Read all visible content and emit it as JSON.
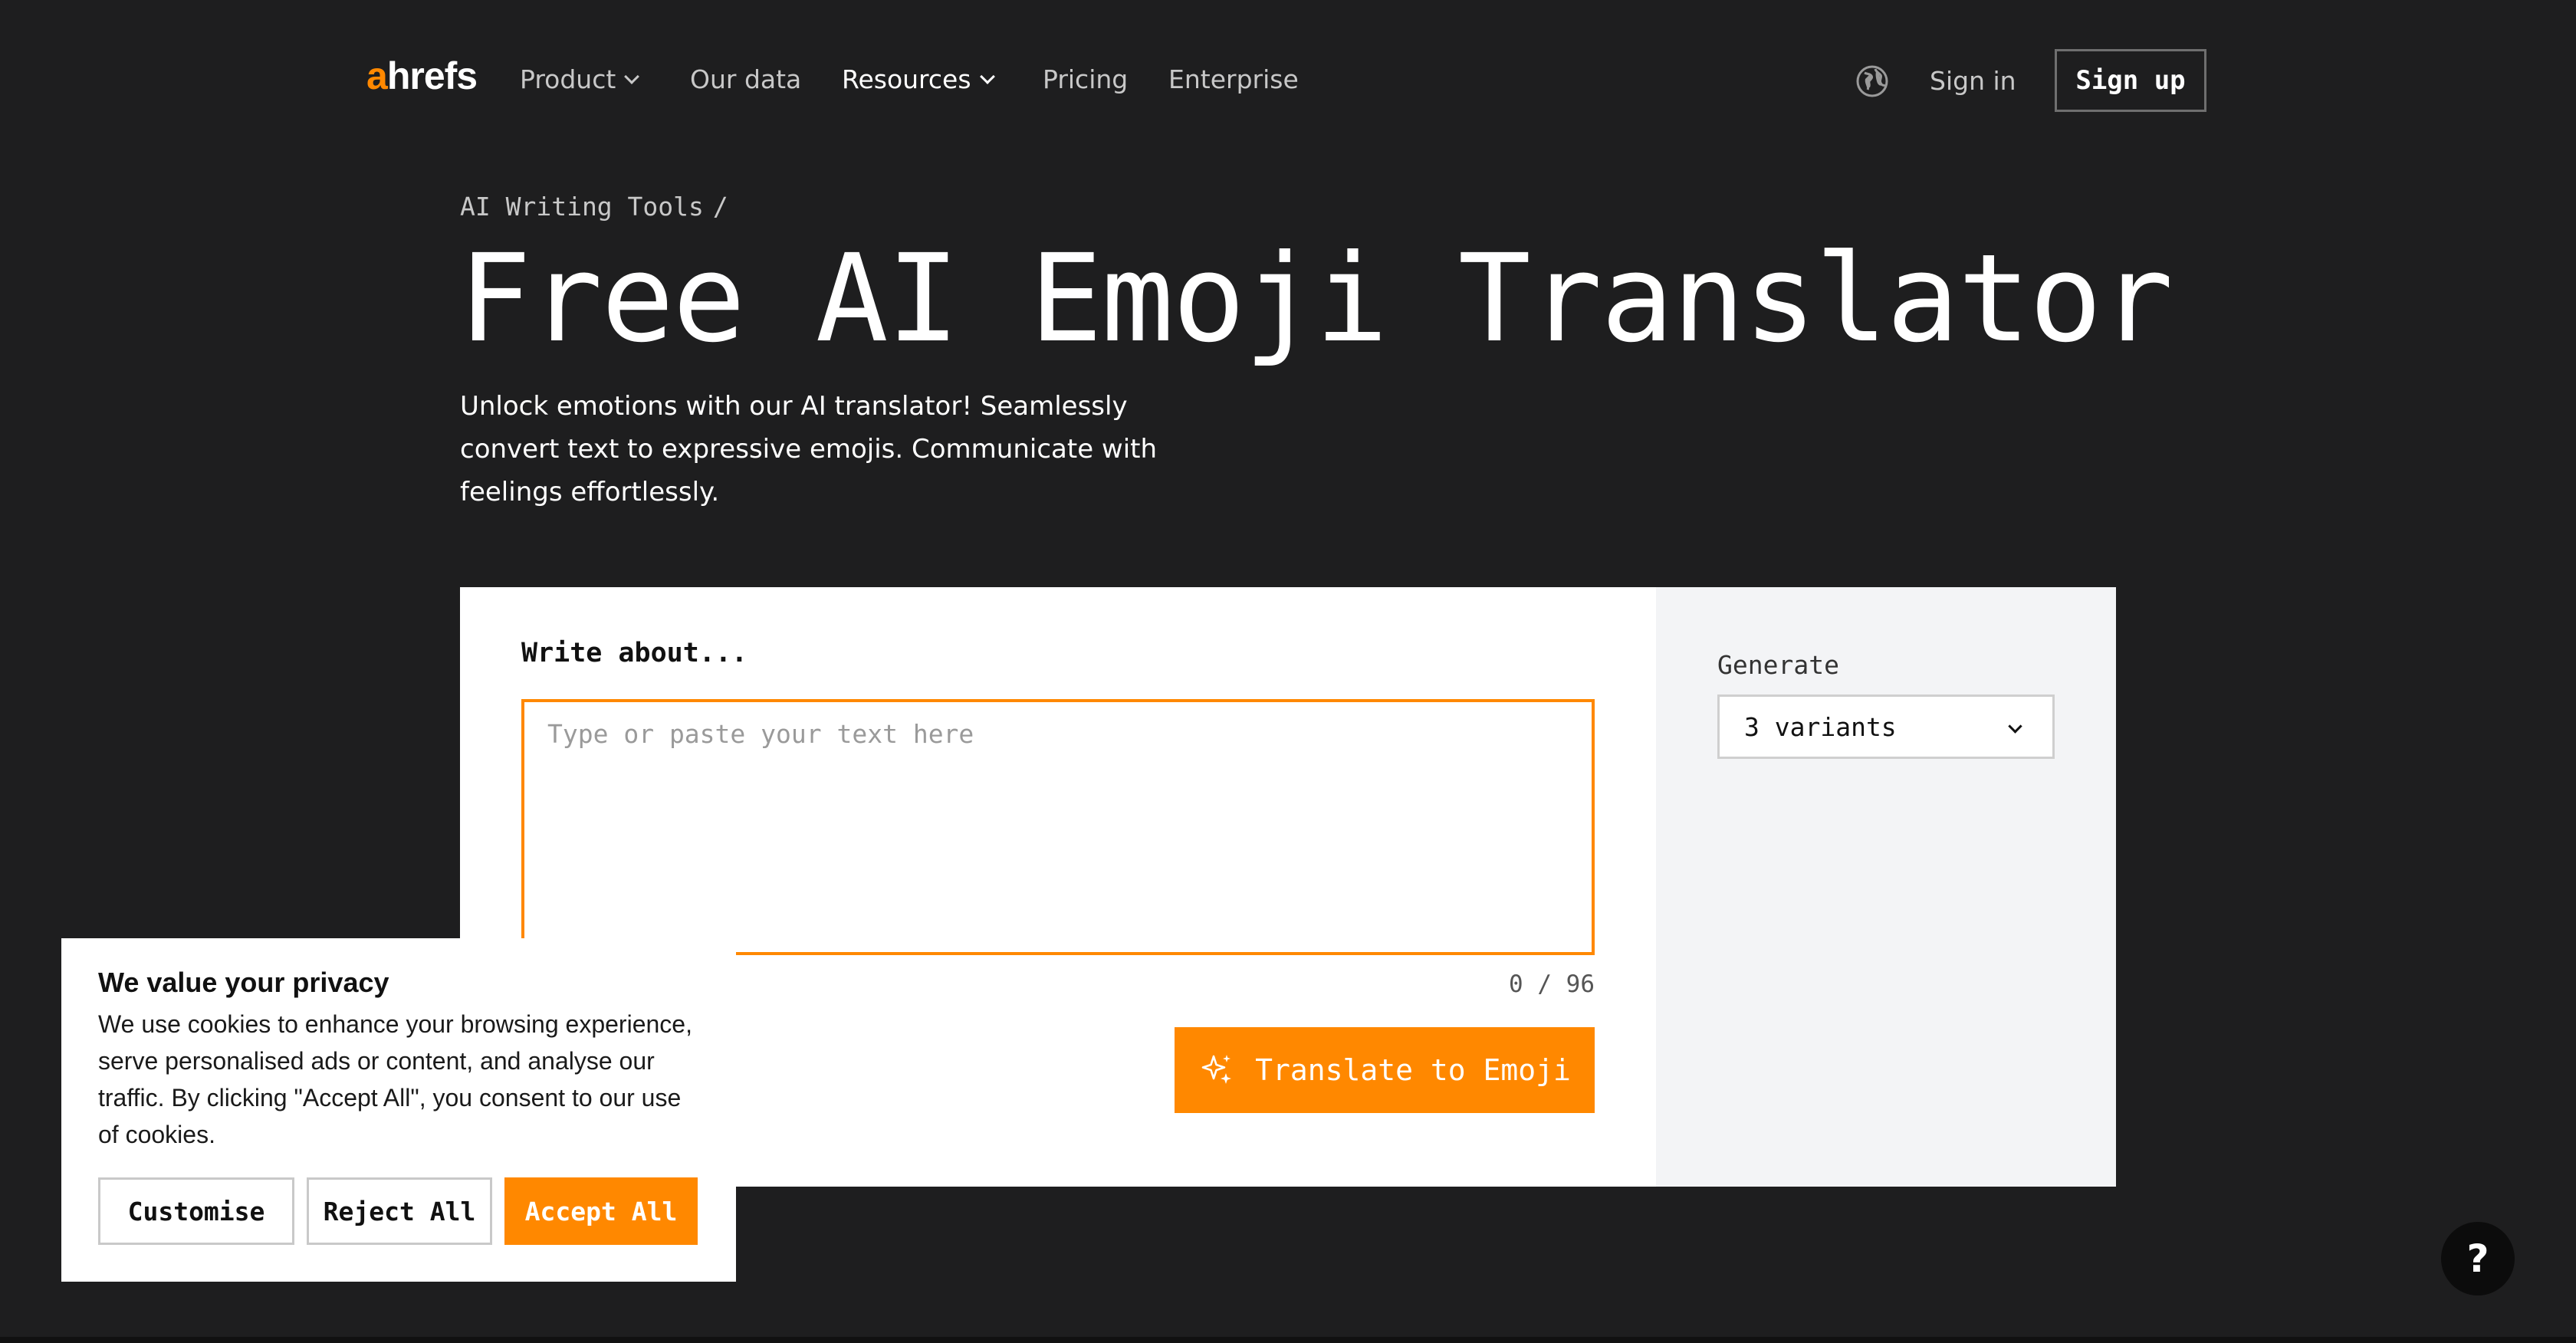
{
  "nav": {
    "logo_prefix": "a",
    "logo_rest": "hrefs",
    "items": [
      {
        "label": "Product",
        "dropdown": true
      },
      {
        "label": "Our data",
        "dropdown": false
      },
      {
        "label": "Resources",
        "dropdown": true
      },
      {
        "label": "Pricing",
        "dropdown": false
      },
      {
        "label": "Enterprise",
        "dropdown": false
      }
    ],
    "language_icon": "globe-icon",
    "sign_in": "Sign in",
    "sign_up": "Sign up"
  },
  "hero": {
    "breadcrumb": "AI Writing Tools",
    "breadcrumb_sep": "/",
    "title": "Free AI Emoji Translator",
    "subtitle": "Unlock emotions with our AI translator! Seamlessly convert text to expressive emojis. Communicate with feelings effortlessly."
  },
  "tool": {
    "write_label": "Write about...",
    "textarea_placeholder": "Type or paste your text here",
    "textarea_value": "",
    "counter": "0 / 96",
    "button_label": "Translate to Emoji",
    "button_icon": "sparkles-icon",
    "generate_label": "Generate",
    "generate_value": "3 variants"
  },
  "cookie": {
    "title": "We value your privacy",
    "text": "We use cookies to enhance your browsing experience, serve personalised ads or content, and analyse our traffic. By clicking \"Accept All\", you consent to our use of cookies.",
    "customise": "Customise",
    "reject": "Reject All",
    "accept": "Accept All"
  },
  "help": {
    "label": "?"
  },
  "colors": {
    "background": "#1e1e1f",
    "accent": "#ff8800",
    "side_panel": "#f3f4f6"
  }
}
